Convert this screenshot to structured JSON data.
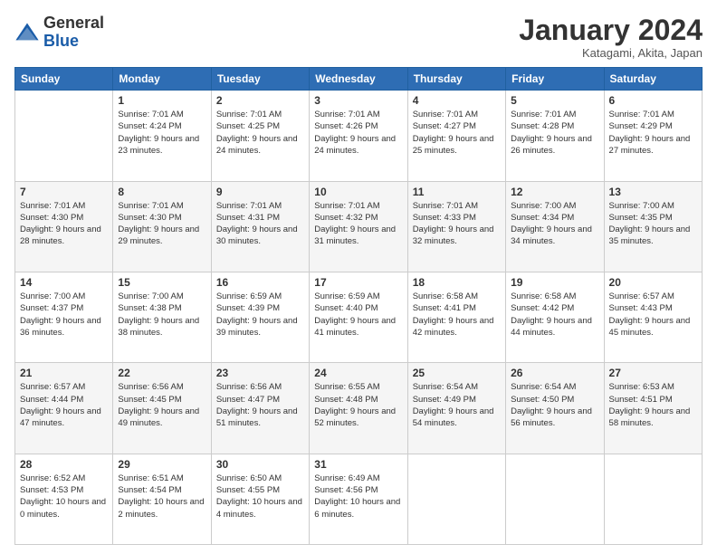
{
  "logo": {
    "general": "General",
    "blue": "Blue"
  },
  "header": {
    "month": "January 2024",
    "location": "Katagami, Akita, Japan"
  },
  "weekdays": [
    "Sunday",
    "Monday",
    "Tuesday",
    "Wednesday",
    "Thursday",
    "Friday",
    "Saturday"
  ],
  "weeks": [
    [
      {
        "day": "",
        "empty": true
      },
      {
        "day": "1",
        "sunrise": "7:01 AM",
        "sunset": "4:24 PM",
        "daylight": "9 hours and 23 minutes."
      },
      {
        "day": "2",
        "sunrise": "7:01 AM",
        "sunset": "4:25 PM",
        "daylight": "9 hours and 24 minutes."
      },
      {
        "day": "3",
        "sunrise": "7:01 AM",
        "sunset": "4:26 PM",
        "daylight": "9 hours and 24 minutes."
      },
      {
        "day": "4",
        "sunrise": "7:01 AM",
        "sunset": "4:27 PM",
        "daylight": "9 hours and 25 minutes."
      },
      {
        "day": "5",
        "sunrise": "7:01 AM",
        "sunset": "4:28 PM",
        "daylight": "9 hours and 26 minutes."
      },
      {
        "day": "6",
        "sunrise": "7:01 AM",
        "sunset": "4:29 PM",
        "daylight": "9 hours and 27 minutes."
      }
    ],
    [
      {
        "day": "7",
        "sunrise": "7:01 AM",
        "sunset": "4:30 PM",
        "daylight": "9 hours and 28 minutes."
      },
      {
        "day": "8",
        "sunrise": "7:01 AM",
        "sunset": "4:30 PM",
        "daylight": "9 hours and 29 minutes."
      },
      {
        "day": "9",
        "sunrise": "7:01 AM",
        "sunset": "4:31 PM",
        "daylight": "9 hours and 30 minutes."
      },
      {
        "day": "10",
        "sunrise": "7:01 AM",
        "sunset": "4:32 PM",
        "daylight": "9 hours and 31 minutes."
      },
      {
        "day": "11",
        "sunrise": "7:01 AM",
        "sunset": "4:33 PM",
        "daylight": "9 hours and 32 minutes."
      },
      {
        "day": "12",
        "sunrise": "7:00 AM",
        "sunset": "4:34 PM",
        "daylight": "9 hours and 34 minutes."
      },
      {
        "day": "13",
        "sunrise": "7:00 AM",
        "sunset": "4:35 PM",
        "daylight": "9 hours and 35 minutes."
      }
    ],
    [
      {
        "day": "14",
        "sunrise": "7:00 AM",
        "sunset": "4:37 PM",
        "daylight": "9 hours and 36 minutes."
      },
      {
        "day": "15",
        "sunrise": "7:00 AM",
        "sunset": "4:38 PM",
        "daylight": "9 hours and 38 minutes."
      },
      {
        "day": "16",
        "sunrise": "6:59 AM",
        "sunset": "4:39 PM",
        "daylight": "9 hours and 39 minutes."
      },
      {
        "day": "17",
        "sunrise": "6:59 AM",
        "sunset": "4:40 PM",
        "daylight": "9 hours and 41 minutes."
      },
      {
        "day": "18",
        "sunrise": "6:58 AM",
        "sunset": "4:41 PM",
        "daylight": "9 hours and 42 minutes."
      },
      {
        "day": "19",
        "sunrise": "6:58 AM",
        "sunset": "4:42 PM",
        "daylight": "9 hours and 44 minutes."
      },
      {
        "day": "20",
        "sunrise": "6:57 AM",
        "sunset": "4:43 PM",
        "daylight": "9 hours and 45 minutes."
      }
    ],
    [
      {
        "day": "21",
        "sunrise": "6:57 AM",
        "sunset": "4:44 PM",
        "daylight": "9 hours and 47 minutes."
      },
      {
        "day": "22",
        "sunrise": "6:56 AM",
        "sunset": "4:45 PM",
        "daylight": "9 hours and 49 minutes."
      },
      {
        "day": "23",
        "sunrise": "6:56 AM",
        "sunset": "4:47 PM",
        "daylight": "9 hours and 51 minutes."
      },
      {
        "day": "24",
        "sunrise": "6:55 AM",
        "sunset": "4:48 PM",
        "daylight": "9 hours and 52 minutes."
      },
      {
        "day": "25",
        "sunrise": "6:54 AM",
        "sunset": "4:49 PM",
        "daylight": "9 hours and 54 minutes."
      },
      {
        "day": "26",
        "sunrise": "6:54 AM",
        "sunset": "4:50 PM",
        "daylight": "9 hours and 56 minutes."
      },
      {
        "day": "27",
        "sunrise": "6:53 AM",
        "sunset": "4:51 PM",
        "daylight": "9 hours and 58 minutes."
      }
    ],
    [
      {
        "day": "28",
        "sunrise": "6:52 AM",
        "sunset": "4:53 PM",
        "daylight": "10 hours and 0 minutes."
      },
      {
        "day": "29",
        "sunrise": "6:51 AM",
        "sunset": "4:54 PM",
        "daylight": "10 hours and 2 minutes."
      },
      {
        "day": "30",
        "sunrise": "6:50 AM",
        "sunset": "4:55 PM",
        "daylight": "10 hours and 4 minutes."
      },
      {
        "day": "31",
        "sunrise": "6:49 AM",
        "sunset": "4:56 PM",
        "daylight": "10 hours and 6 minutes."
      },
      {
        "day": "",
        "empty": true
      },
      {
        "day": "",
        "empty": true
      },
      {
        "day": "",
        "empty": true
      }
    ]
  ]
}
